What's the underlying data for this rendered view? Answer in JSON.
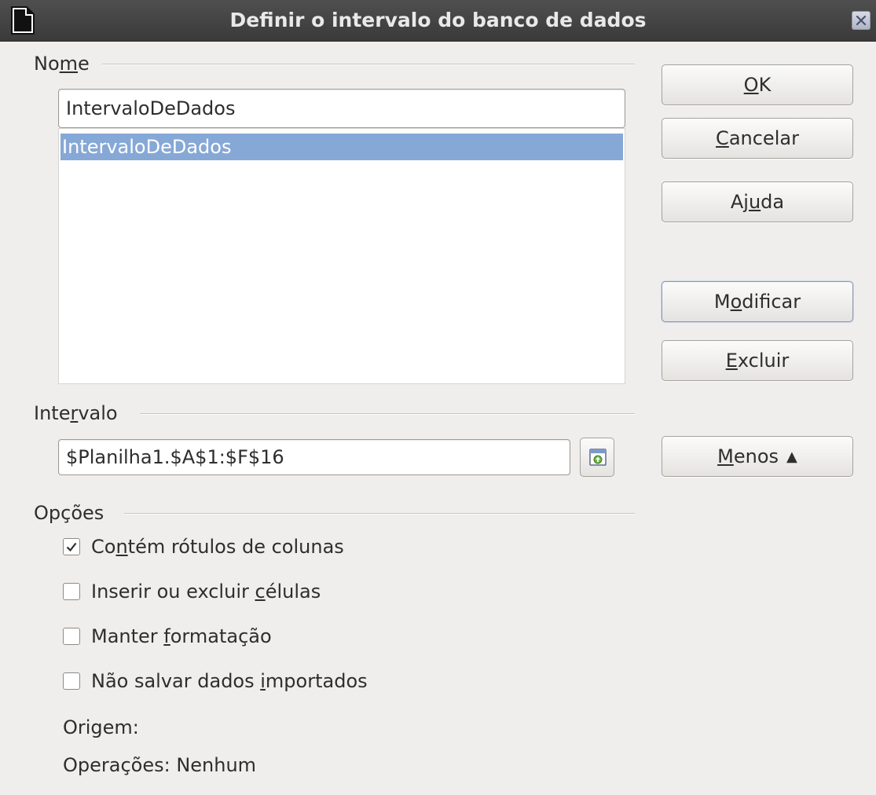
{
  "window": {
    "title": "Definir o intervalo do banco de dados"
  },
  "name_section": {
    "label_prefix": "No",
    "label_access": "m",
    "label_suffix": "e",
    "input_value": "IntervaloDeDados",
    "list_items": [
      "IntervaloDeDados"
    ]
  },
  "range_section": {
    "label_prefix": "Inte",
    "label_access": "r",
    "label_suffix": "valo",
    "input_value": "$Planilha1.$A$1:$F$16"
  },
  "options_section": {
    "label": "Opções",
    "checkboxes": [
      {
        "pre": "Co",
        "acc": "n",
        "post": "tém rótulos de colunas",
        "checked": true
      },
      {
        "pre": "Inserir ou excluir ",
        "acc": "c",
        "post": "élulas",
        "checked": false
      },
      {
        "pre": "Manter ",
        "acc": "f",
        "post": "ormatação",
        "checked": false
      },
      {
        "pre": "Não salvar dados ",
        "acc": "i",
        "post": "mportados",
        "checked": false
      }
    ],
    "origin_label": "Origem:",
    "operations_label": "Operações: Nenhum"
  },
  "buttons": {
    "ok": {
      "pre": "",
      "acc": "O",
      "post": "K"
    },
    "cancel": {
      "pre": "",
      "acc": "C",
      "post": "ancelar"
    },
    "help": {
      "pre": "Aj",
      "acc": "u",
      "post": "da"
    },
    "modify": {
      "pre": "M",
      "acc": "o",
      "post": "dificar"
    },
    "delete": {
      "pre": "",
      "acc": "E",
      "post": "xcluir"
    },
    "less": {
      "pre": "",
      "acc": "M",
      "post": "enos",
      "chevron": "▲"
    }
  },
  "colors": {
    "selection": "#86a8d6",
    "dialog_bg": "#efeeed",
    "titlebar": "#3c3c3c"
  },
  "icons": {
    "window": "document-icon",
    "close": "close-icon",
    "shrink": "shrink-range-icon",
    "check": "checkmark-icon"
  }
}
